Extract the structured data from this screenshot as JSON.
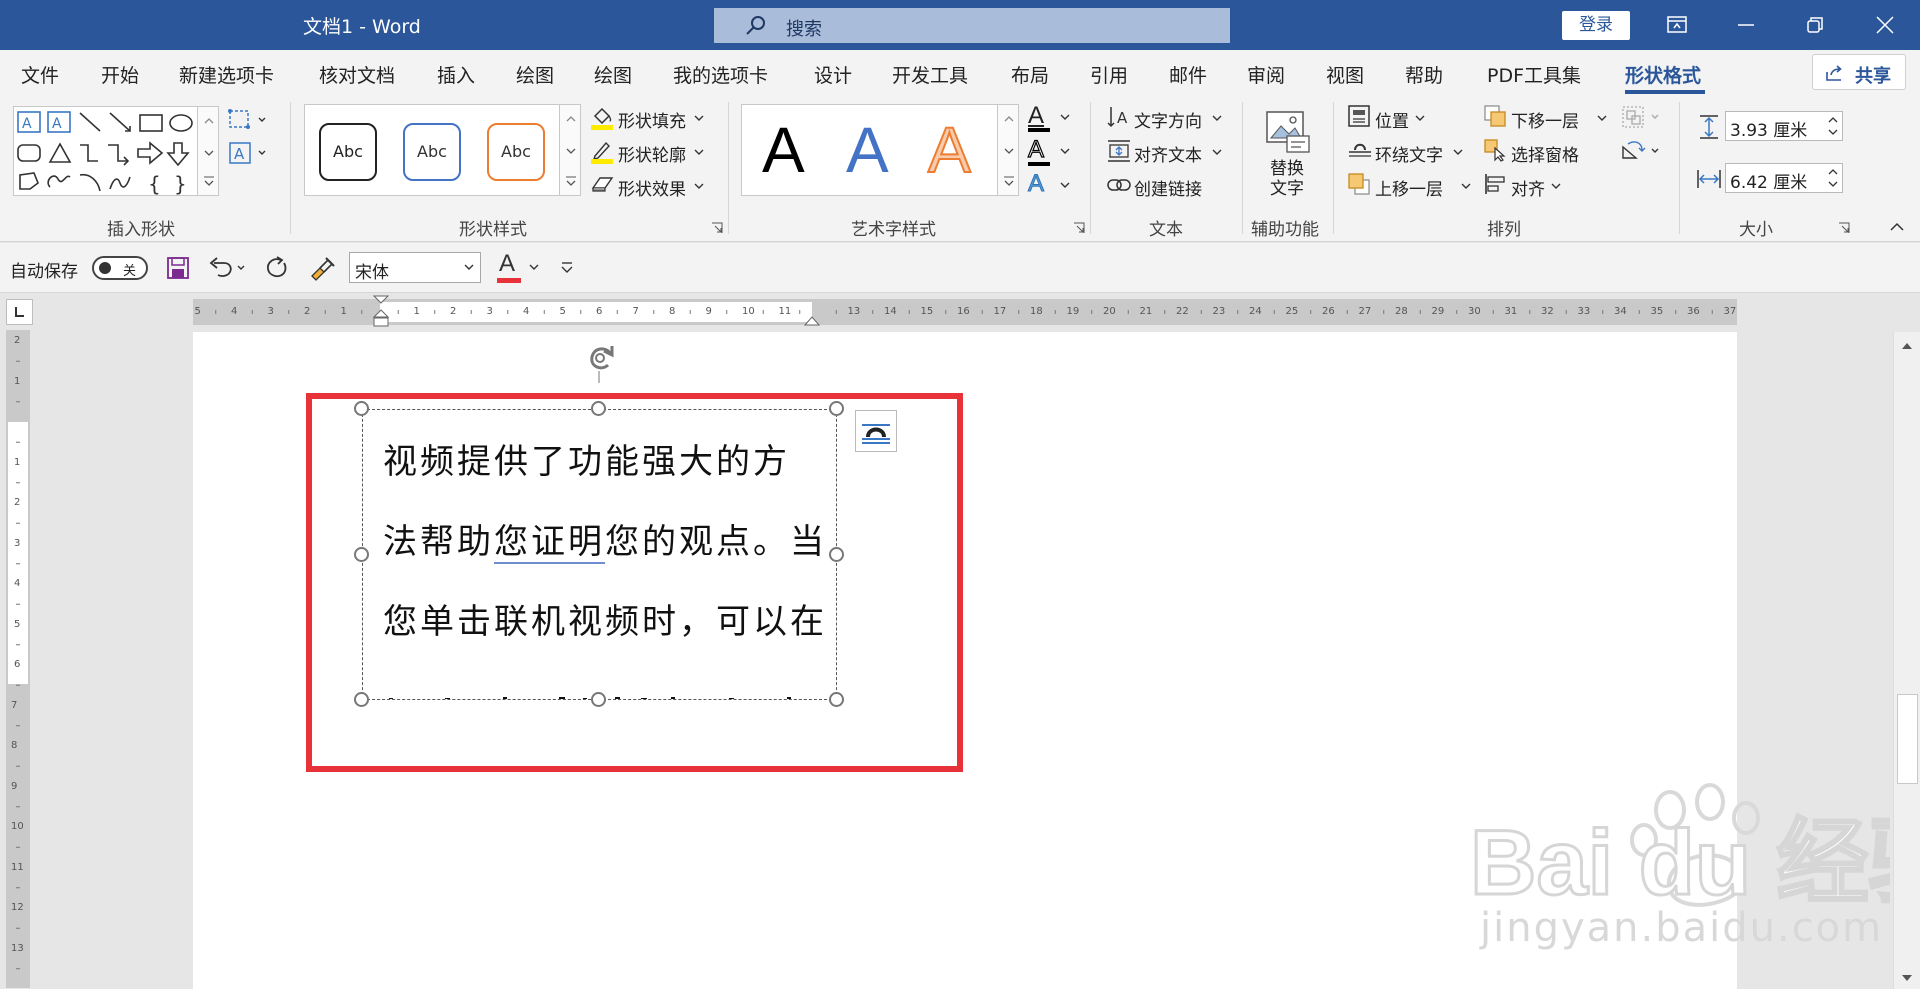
{
  "titlebar": {
    "title": "文档1  -  Word",
    "search_placeholder": "搜索",
    "login": "登录"
  },
  "tabs": [
    "文件",
    "开始",
    "新建选项卡",
    "核对文档",
    "插入",
    "绘图",
    "绘图",
    "我的选项卡",
    "设计",
    "开发工具",
    "布局",
    "引用",
    "邮件",
    "审阅",
    "视图",
    "帮助",
    "PDF工具集",
    "形状格式"
  ],
  "active_tab": "形状格式",
  "share": "共享",
  "ribbon": {
    "groups": {
      "insert_shapes": "插入形状",
      "shape_styles": "形状样式",
      "wordart_styles": "艺术字样式",
      "text": "文本",
      "accessibility": "辅助功能",
      "arrange": "排列",
      "size": "大小"
    },
    "style_gallery": [
      "Abc",
      "Abc",
      "Abc"
    ],
    "shape_fill": "形状填充",
    "shape_outline": "形状轮廓",
    "shape_effects": "形状效果",
    "wordart_gallery": [
      "A",
      "A",
      "A"
    ],
    "text_fill_glyph": "A",
    "text_outline_glyph": "A",
    "text_effects_glyph": "A",
    "text_direction": "文字方向",
    "align_text": "对齐文本",
    "create_link": "创建链接",
    "alt_text_line1": "替换",
    "alt_text_line2": "文字",
    "position": "位置",
    "wrap_text": "环绕文字",
    "bring_forward": "上移一层",
    "send_backward": "下移一层",
    "selection_pane": "选择窗格",
    "align": "对齐",
    "height": "3.93 厘米",
    "width": "6.42 厘米"
  },
  "qat": {
    "autosave": "自动保存",
    "toggle_state": "关",
    "font": "宋体",
    "font_color_glyph": "A"
  },
  "ruler": {
    "h_left": [
      "5",
      "4",
      "3",
      "2",
      "1"
    ],
    "h_white": [
      "1",
      "2",
      "3",
      "4",
      "5",
      "6",
      "7",
      "8",
      "9",
      "10",
      "11"
    ],
    "h_right": [
      "13",
      "14",
      "15",
      "16",
      "17",
      "18",
      "19",
      "20",
      "21",
      "22",
      "23",
      "24",
      "25",
      "26",
      "27",
      "28",
      "29",
      "30",
      "31",
      "32",
      "33",
      "34",
      "35",
      "36",
      "37"
    ],
    "v_top": [
      "2",
      "1"
    ],
    "v_white": [
      "1",
      "2",
      "3",
      "4",
      "5",
      "6"
    ],
    "v_bottom": [
      "7",
      "8",
      "9",
      "10",
      "11",
      "12",
      "13"
    ]
  },
  "document": {
    "lines": [
      "视频提供了功能强大的方",
      "法帮助您证明您的观点。当",
      "您单击联机视频时，可以在"
    ]
  },
  "watermark": {
    "logo": "Bai du 经验",
    "url": "jingyan.baidu.com"
  },
  "colors": {
    "brand": "#2b579a",
    "highlight_box": "#e8323a"
  }
}
